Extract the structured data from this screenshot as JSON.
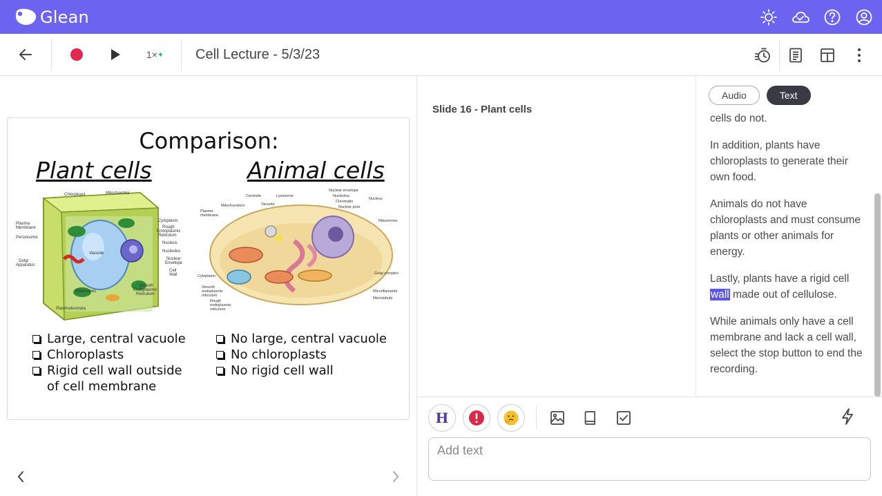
{
  "app": {
    "name": "Glean"
  },
  "topbar": {
    "icons": [
      "sun-icon",
      "cloud-check-icon",
      "help-icon",
      "account-icon"
    ]
  },
  "toolbar": {
    "speed": "1×",
    "title": "Cell Lecture - 5/3/23",
    "right_icons": [
      "timer-icon",
      "notes-icon",
      "layout-icon",
      "more-icon"
    ]
  },
  "slide": {
    "title": "Comparison:",
    "plant_heading": "Plant cells",
    "animal_heading": "Animal cells",
    "plant_bullets": [
      "Large, central vacuole",
      "Chloroplasts",
      "Rigid cell wall outside of cell membrane"
    ],
    "animal_bullets": [
      "No large, central vacuole",
      "No chloroplasts",
      "No rigid cell wall"
    ],
    "plant_labels": [
      "Chloroplast",
      "Mitochondria",
      "Plasma Membrane",
      "Peroxisome",
      "Golgi Apparatus",
      "Vacuole",
      "Cytoplasm",
      "Rough Endoplasmic Reticulum",
      "Nucleus",
      "Nucleolus",
      "Nuclear Envelope",
      "Cell Wall",
      "Smooth Endoplasmic Reticulum",
      "Ribosomes",
      "Plasmodesmata"
    ],
    "animal_labels": [
      "Centriole",
      "Lysosome",
      "Nuclear envelope",
      "Nucleolus",
      "Chromatin",
      "Nuclear pore",
      "Nucleus",
      "Mitochondrion",
      "Vacuole",
      "Plasma membrane",
      "Ribosomes",
      "Cytoplasm",
      "Golgi complex",
      "Smooth endoplasmic reticulum",
      "Rough endoplasmic reticulum",
      "Microfilaments",
      "Microtubule"
    ]
  },
  "notes": {
    "slide_label": "Slide 16 - Plant cells"
  },
  "transcript": {
    "tabs": {
      "audio": "Audio",
      "text": "Text"
    },
    "p1": "cells do not.",
    "p2": "In addition, plants have chloroplasts to generate their own food.",
    "p3": "Animals do not have chloroplasts and must consume plants or other animals for energy.",
    "p4_before": "Lastly, plants have a rigid cell ",
    "p4_highlight": "wall",
    "p4_after": " made out of cellulose.",
    "p5": "While animals only have a cell membrane and lack a cell wall, select the stop button to end the recording."
  },
  "editor": {
    "heading_btn": "H",
    "placeholder": "Add text"
  },
  "colors": {
    "brand": "#6c63f0",
    "record": "#e0294f",
    "highlight": "#5b55e8",
    "spark": "#14b8a6"
  }
}
